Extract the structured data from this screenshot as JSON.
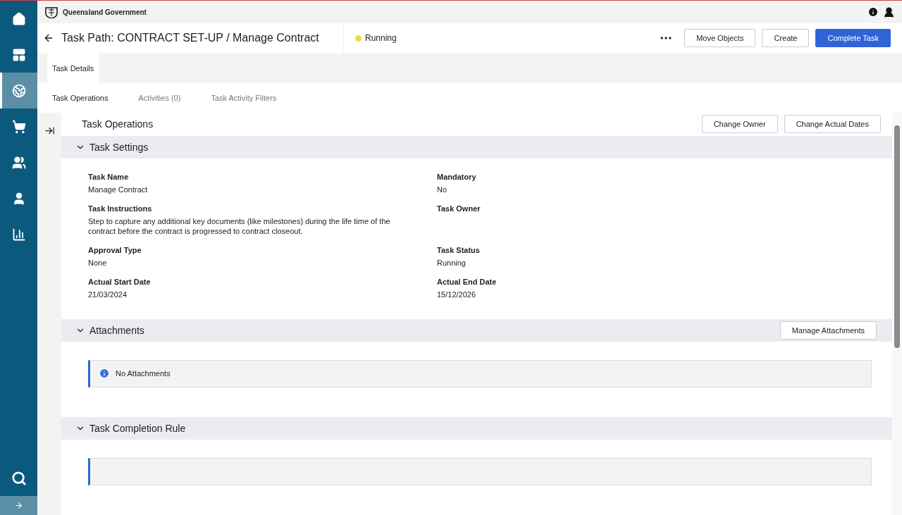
{
  "brand": "Queensland Government",
  "sidebar": {
    "items": [
      {
        "selected": false
      },
      {
        "selected": false
      },
      {
        "selected": true
      },
      {
        "selected": false
      },
      {
        "selected": false
      },
      {
        "selected": false
      },
      {
        "selected": false
      }
    ]
  },
  "header": {
    "title": "Task Path: CONTRACT SET-UP / Manage Contract",
    "status": {
      "label": "Running",
      "color": "#f5d742"
    },
    "buttons": [
      {
        "label": "Move Objects",
        "primary": false
      },
      {
        "label": "Create",
        "primary": false
      },
      {
        "label": "Complete Task",
        "primary": true
      }
    ]
  },
  "tabs": [
    {
      "label": "Task Details",
      "selected": true
    }
  ],
  "subtabs": [
    {
      "label": "Task Operations",
      "selected": true
    },
    {
      "label": "Activities (0)",
      "selected": false
    },
    {
      "label": "Task Activity Filters",
      "selected": false
    }
  ],
  "panel": {
    "title": "Task Operations",
    "buttons": [
      "Change Owner",
      "Change Actual Dates"
    ]
  },
  "sections": [
    {
      "kind": "fields",
      "title": "Task Settings",
      "expanded": true,
      "fields": [
        {
          "label": "Task Name",
          "value": "Manage Contract"
        },
        {
          "label": "Mandatory",
          "value": "No"
        },
        {
          "label": "Task Instructions",
          "value": "Step to capture any additional key documents (like milestones) during the life time of the contract before the contract is progressed to contract closeout."
        },
        {
          "label": "Task Owner"
        },
        {
          "label": "Approval Type",
          "value": "None"
        },
        {
          "label": "Task Status",
          "value": "Running"
        },
        {
          "label": "Actual Start Date",
          "value": "21/03/2024"
        },
        {
          "label": "Actual End Date",
          "value": "15/12/2026"
        }
      ]
    },
    {
      "kind": "notice",
      "title": "Attachments",
      "expanded": true,
      "button": "Manage Attachments",
      "notice": "No Attachments"
    },
    {
      "kind": "notice",
      "title": "Task Completion Rule",
      "expanded": true
    }
  ]
}
